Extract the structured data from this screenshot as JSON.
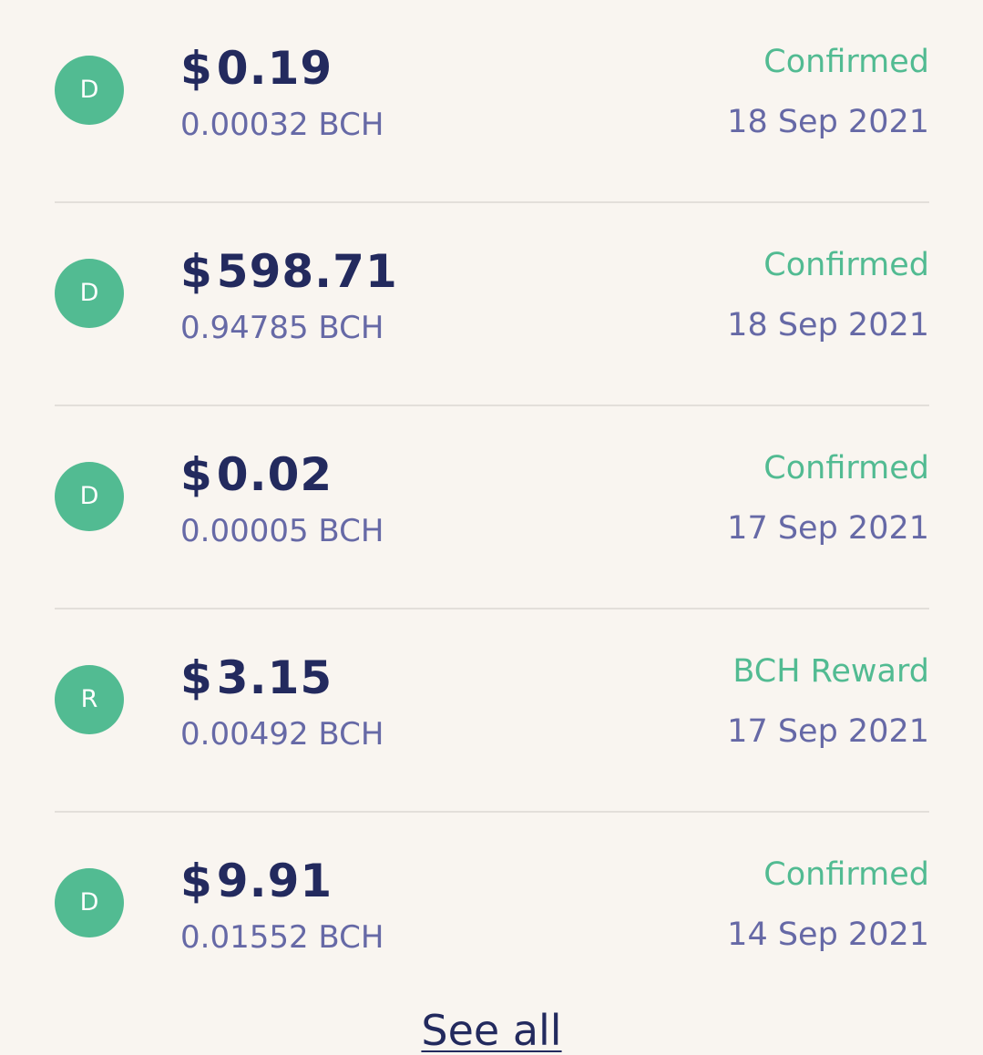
{
  "colors": {
    "background": "#f9f5f0",
    "accent": "#52bb92",
    "primary_text": "#232a5e",
    "secondary_text": "#6669a6",
    "divider": "#e3dfda"
  },
  "transactions": [
    {
      "avatar": "D",
      "currency_symbol": "$",
      "amount": "0.19",
      "crypto": "0.00032 BCH",
      "status": "Confirmed",
      "date": "18 Sep 2021"
    },
    {
      "avatar": "D",
      "currency_symbol": "$",
      "amount": "598.71",
      "crypto": "0.94785 BCH",
      "status": "Confirmed",
      "date": "18 Sep 2021"
    },
    {
      "avatar": "D",
      "currency_symbol": "$",
      "amount": "0.02",
      "crypto": "0.00005 BCH",
      "status": "Confirmed",
      "date": "17 Sep 2021"
    },
    {
      "avatar": "R",
      "currency_symbol": "$",
      "amount": "3.15",
      "crypto": "0.00492 BCH",
      "status": "BCH Reward",
      "date": "17 Sep 2021"
    },
    {
      "avatar": "D",
      "currency_symbol": "$",
      "amount": "9.91",
      "crypto": "0.01552 BCH",
      "status": "Confirmed",
      "date": "14 Sep 2021"
    }
  ],
  "footer": {
    "see_all_label": "See all"
  }
}
